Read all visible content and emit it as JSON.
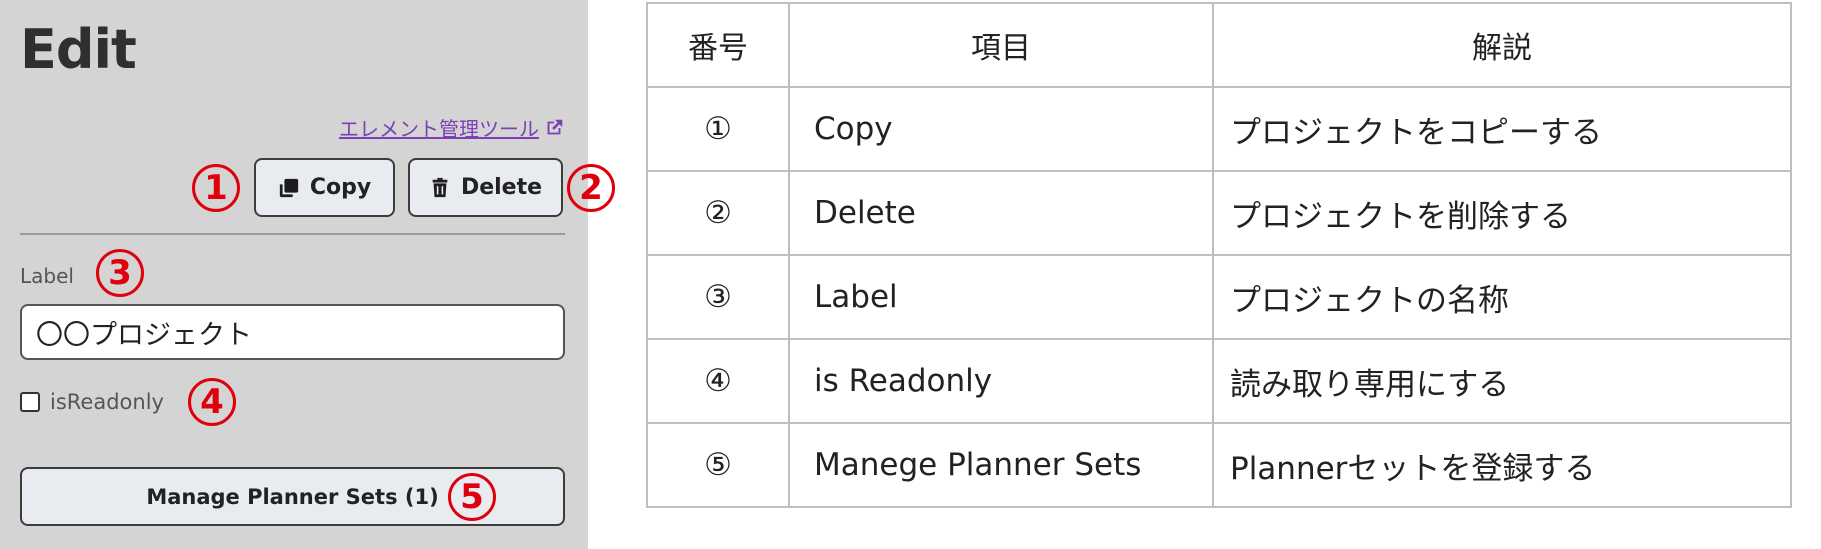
{
  "panel": {
    "title": "Edit",
    "link_label": "エレメント管理ツール",
    "copy_label": "Copy",
    "delete_label": "Delete",
    "field_label": "Label",
    "label_value": "〇〇プロジェクト",
    "checkbox_label": "isReadonly",
    "manage_label": "Manage Planner Sets (1)",
    "markers": [
      "1",
      "2",
      "3",
      "4",
      "5"
    ]
  },
  "table": {
    "headers": [
      "番号",
      "項目",
      "解説"
    ],
    "rows": [
      {
        "num": "①",
        "item": "Copy",
        "desc": "プロジェクトをコピーする"
      },
      {
        "num": "②",
        "item": "Delete",
        "desc": "プロジェクトを削除する"
      },
      {
        "num": "③",
        "item": "Label",
        "desc": "プロジェクトの名称"
      },
      {
        "num": "④",
        "item": "is Readonly",
        "desc": "読み取り専用にする"
      },
      {
        "num": "⑤",
        "item": "Manege Planner Sets",
        "desc": "Plannerセットを登録する"
      }
    ]
  },
  "colors": {
    "panel_bg": "#d4d4d4",
    "marker": "#e0000b",
    "link": "#7c3fb5",
    "button_bg": "#e8ecf0"
  }
}
